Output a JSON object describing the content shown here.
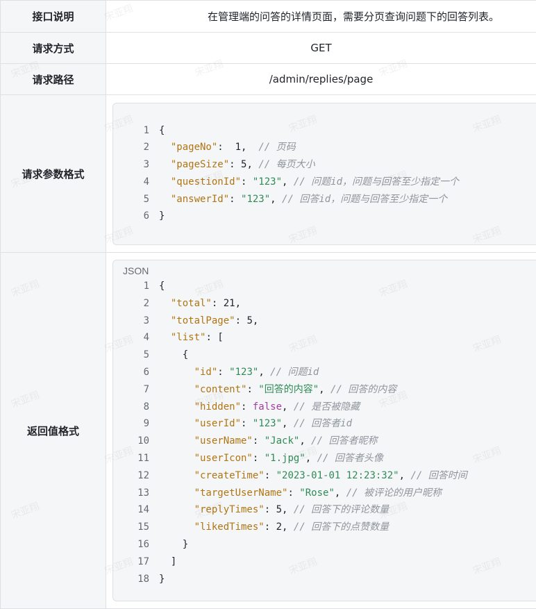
{
  "rows": {
    "desc": {
      "label": "接口说明",
      "value": "在管理端的问答的详情页面，需要分页查询问题下的回答列表。"
    },
    "method": {
      "label": "请求方式",
      "value": "GET"
    },
    "path": {
      "label": "请求路径",
      "value": "/admin/replies/page"
    },
    "params": {
      "label": "请求参数格式"
    },
    "response": {
      "label": "返回值格式",
      "lang": "JSON"
    }
  },
  "request_code": [
    [
      [
        "p",
        "{"
      ]
    ],
    [
      [
        "p",
        "  "
      ],
      [
        "key",
        "\"pageNo\""
      ],
      [
        "p",
        ":  "
      ],
      [
        "num",
        "1"
      ],
      [
        "p",
        ",  "
      ],
      [
        "com",
        "// 页码"
      ]
    ],
    [
      [
        "p",
        "  "
      ],
      [
        "key",
        "\"pageSize\""
      ],
      [
        "p",
        ": "
      ],
      [
        "num",
        "5"
      ],
      [
        "p",
        ", "
      ],
      [
        "com",
        "// 每页大小"
      ]
    ],
    [
      [
        "p",
        "  "
      ],
      [
        "key",
        "\"questionId\""
      ],
      [
        "p",
        ": "
      ],
      [
        "str",
        "\"123\""
      ],
      [
        "p",
        ", "
      ],
      [
        "com",
        "// 问题id，问题与回答至少指定一个"
      ]
    ],
    [
      [
        "p",
        "  "
      ],
      [
        "key",
        "\"answerId\""
      ],
      [
        "p",
        ": "
      ],
      [
        "str",
        "\"123\""
      ],
      [
        "p",
        ", "
      ],
      [
        "com",
        "// 回答id，问题与回答至少指定一个"
      ]
    ],
    [
      [
        "p",
        "}"
      ]
    ]
  ],
  "response_code": [
    [
      [
        "p",
        "{"
      ]
    ],
    [
      [
        "p",
        "  "
      ],
      [
        "key",
        "\"total\""
      ],
      [
        "p",
        ": "
      ],
      [
        "num",
        "21"
      ],
      [
        "p",
        ","
      ]
    ],
    [
      [
        "p",
        "  "
      ],
      [
        "key",
        "\"totalPage\""
      ],
      [
        "p",
        ": "
      ],
      [
        "num",
        "5"
      ],
      [
        "p",
        ","
      ]
    ],
    [
      [
        "p",
        "  "
      ],
      [
        "key",
        "\"list\""
      ],
      [
        "p",
        ": ["
      ]
    ],
    [
      [
        "p",
        "    {"
      ]
    ],
    [
      [
        "p",
        "      "
      ],
      [
        "key",
        "\"id\""
      ],
      [
        "p",
        ": "
      ],
      [
        "str",
        "\"123\""
      ],
      [
        "p",
        ", "
      ],
      [
        "com",
        "// 问题id"
      ]
    ],
    [
      [
        "p",
        "      "
      ],
      [
        "key",
        "\"content\""
      ],
      [
        "p",
        ": "
      ],
      [
        "str",
        "\"回答的内容\""
      ],
      [
        "p",
        ", "
      ],
      [
        "com",
        "// 回答的内容"
      ]
    ],
    [
      [
        "p",
        "      "
      ],
      [
        "key",
        "\"hidden\""
      ],
      [
        "p",
        ": "
      ],
      [
        "bool",
        "false"
      ],
      [
        "p",
        ", "
      ],
      [
        "com",
        "// 是否被隐藏"
      ]
    ],
    [
      [
        "p",
        "      "
      ],
      [
        "key",
        "\"userId\""
      ],
      [
        "p",
        ": "
      ],
      [
        "str",
        "\"123\""
      ],
      [
        "p",
        ", "
      ],
      [
        "com",
        "// 回答者id"
      ]
    ],
    [
      [
        "p",
        "      "
      ],
      [
        "key",
        "\"userName\""
      ],
      [
        "p",
        ": "
      ],
      [
        "str",
        "\"Jack\""
      ],
      [
        "p",
        ", "
      ],
      [
        "com",
        "// 回答者昵称"
      ]
    ],
    [
      [
        "p",
        "      "
      ],
      [
        "key",
        "\"userIcon\""
      ],
      [
        "p",
        ": "
      ],
      [
        "str",
        "\"1.jpg\""
      ],
      [
        "p",
        ", "
      ],
      [
        "com",
        "// 回答者头像"
      ]
    ],
    [
      [
        "p",
        "      "
      ],
      [
        "key",
        "\"createTime\""
      ],
      [
        "p",
        ": "
      ],
      [
        "str",
        "\"2023-01-01 12:23:32\""
      ],
      [
        "p",
        ", "
      ],
      [
        "com",
        "// 回答时间"
      ]
    ],
    [
      [
        "p",
        "      "
      ],
      [
        "key",
        "\"targetUserName\""
      ],
      [
        "p",
        ": "
      ],
      [
        "str",
        "\"Rose\""
      ],
      [
        "p",
        ", "
      ],
      [
        "com",
        "// 被评论的用户昵称"
      ]
    ],
    [
      [
        "p",
        "      "
      ],
      [
        "key",
        "\"replyTimes\""
      ],
      [
        "p",
        ": "
      ],
      [
        "num",
        "5"
      ],
      [
        "p",
        ", "
      ],
      [
        "com",
        "// 回答下的评论数量"
      ]
    ],
    [
      [
        "p",
        "      "
      ],
      [
        "key",
        "\"likedTimes\""
      ],
      [
        "p",
        ": "
      ],
      [
        "num",
        "2"
      ],
      [
        "p",
        ", "
      ],
      [
        "com",
        "// 回答下的点赞数量"
      ]
    ],
    [
      [
        "p",
        "    }"
      ]
    ],
    [
      [
        "p",
        "  ]"
      ]
    ],
    [
      [
        "p",
        "}"
      ]
    ]
  ],
  "watermark": "宋亚翔"
}
